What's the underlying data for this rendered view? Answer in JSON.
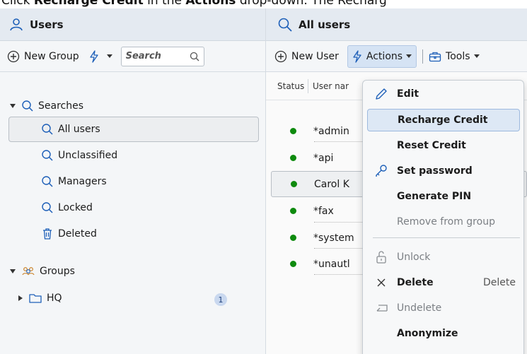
{
  "instruction": {
    "prefix": "Click ",
    "target": "Recharge Credit",
    "middle": " in the ",
    "menu": "Actions",
    "suffix": " drop-down. The Recharg"
  },
  "left_panel": {
    "title": "Users",
    "toolbar": {
      "new_group_label": "New Group",
      "search_placeholder": "Search"
    },
    "tree": {
      "searches_label": "Searches",
      "items": [
        "All users",
        "Unclassified",
        "Managers",
        "Locked",
        "Deleted"
      ],
      "groups_label": "Groups",
      "group_name": "HQ",
      "group_count": "1"
    }
  },
  "right_panel": {
    "title": "All users",
    "toolbar": {
      "new_user_label": "New User",
      "actions_label": "Actions",
      "tools_label": "Tools"
    },
    "columns": [
      "Status",
      "User nar"
    ],
    "rows": [
      "*admin",
      "*api",
      "Carol K",
      "*fax",
      "*system",
      "*unautl"
    ]
  },
  "actions_menu": {
    "items": [
      {
        "label": "Edit",
        "icon": "pencil-icon",
        "enabled": true
      },
      {
        "label": "Recharge Credit",
        "icon": "",
        "enabled": true,
        "highlighted": true
      },
      {
        "label": "Reset Credit",
        "icon": "",
        "enabled": true
      },
      {
        "label": "Set password",
        "icon": "key-icon",
        "enabled": true
      },
      {
        "label": "Generate PIN",
        "icon": "",
        "enabled": true
      },
      {
        "label": "Remove from group",
        "icon": "",
        "enabled": false
      },
      {
        "label": "Unlock",
        "icon": "unlock-icon",
        "enabled": false
      },
      {
        "label": "Delete",
        "icon": "close-icon",
        "enabled": true,
        "shortcut": "Delete"
      },
      {
        "label": "Undelete",
        "icon": "undo-icon",
        "enabled": false
      },
      {
        "label": "Anonymize",
        "icon": "",
        "enabled": true
      }
    ]
  },
  "colors": {
    "accent": "#1d5fb8",
    "status_active": "#0d8a0d",
    "header_bg": "#e4eaf1",
    "highlight_bg": "#dde8f5"
  }
}
